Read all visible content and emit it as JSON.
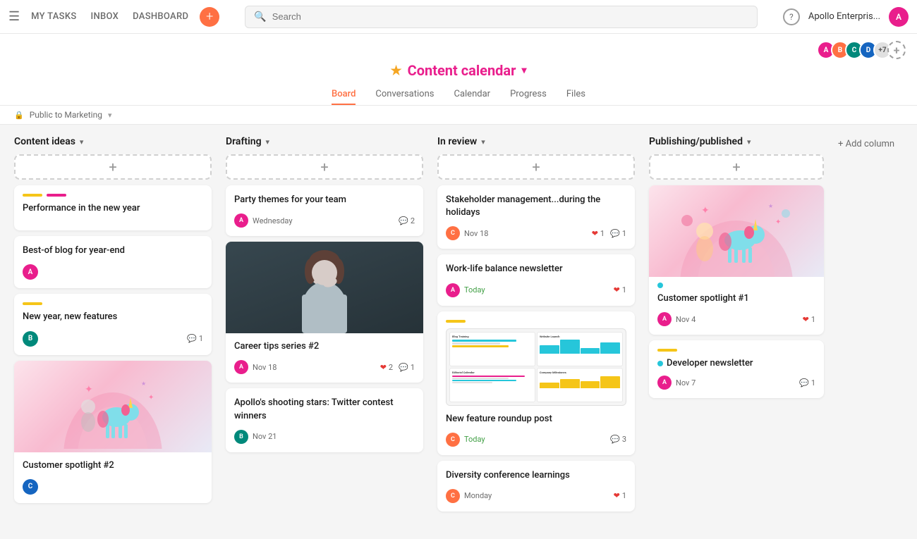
{
  "nav": {
    "menu_icon": "☰",
    "links": [
      "MY TASKS",
      "INBOX",
      "DASHBOARD"
    ],
    "add_icon": "+",
    "search_placeholder": "Search",
    "help_icon": "?",
    "company": "Apollo Enterpris...",
    "public_label": "Public to Marketing",
    "chevron": "▾"
  },
  "project": {
    "star": "★",
    "title": "Content calendar",
    "chevron": "▾",
    "tabs": [
      "Board",
      "Conversations",
      "Calendar",
      "Progress",
      "Files"
    ],
    "active_tab": 0
  },
  "columns": [
    {
      "id": "content-ideas",
      "title": "Content ideas",
      "cards": [
        {
          "tags": [
            "#f5c518",
            "#e91e8c"
          ],
          "title": "Performance in the new year",
          "hasImage": false,
          "hasTags": true
        },
        {
          "tags": [],
          "title": "Best-of blog for year-end",
          "avatar": "av-pink",
          "avatarInitial": "A",
          "hasTags": false
        },
        {
          "tags": [
            "#f5c518"
          ],
          "title": "New year, new features",
          "avatar": "av-teal",
          "avatarInitial": "B",
          "comments": 1,
          "hasTags": true
        },
        {
          "hasIllustration": "customer2",
          "title": "Customer spotlight #2",
          "avatar": "av-blue",
          "avatarInitial": "C",
          "hasTags": false
        }
      ]
    },
    {
      "id": "drafting",
      "title": "Drafting",
      "cards": [
        {
          "title": "Party themes for your team",
          "avatar": "av-pink",
          "avatarInitial": "A",
          "date": "Wednesday",
          "comments": 2,
          "hasTags": false
        },
        {
          "hasPersonPhoto": true,
          "title": "Career tips series #2",
          "avatar": "av-pink",
          "avatarInitial": "A",
          "date": "Nov 18",
          "hearts": 2,
          "comments": 1,
          "hasTags": false
        },
        {
          "title": "Apollo's shooting stars: Twitter contest winners",
          "avatar": "av-teal",
          "avatarInitial": "B",
          "date": "Nov 21",
          "hasTags": false
        }
      ]
    },
    {
      "id": "in-review",
      "title": "In review",
      "cards": [
        {
          "title": "Stakeholder management...during the holidays",
          "avatar": "av-orange",
          "avatarInitial": "C",
          "date": "Nov 18",
          "hearts": 1,
          "comments": 1,
          "hasTags": false
        },
        {
          "title": "Work-life balance newsletter",
          "avatar": "av-pink",
          "avatarInitial": "A",
          "date": "Today",
          "date_green": true,
          "hearts": 1,
          "hasTags": false
        },
        {
          "hasDashboard": true,
          "title": "New feature roundup post",
          "avatar": "av-orange",
          "avatarInitial": "C",
          "date": "Today",
          "date_green": true,
          "comments": 3,
          "hasTags": false,
          "tag_yellow": true
        },
        {
          "title": "Diversity conference learnings",
          "avatar": "av-orange",
          "avatarInitial": "C",
          "date": "Monday",
          "hearts": 1,
          "hasTags": false
        }
      ]
    },
    {
      "id": "publishing",
      "title": "Publishing/published",
      "cards": [
        {
          "hasUnicorn": true,
          "title": "Customer spotlight #1",
          "avatar": "av-pink",
          "avatarInitial": "A",
          "date": "Nov 4",
          "hearts": 1,
          "status_color": "#26c6da",
          "hasTags": false,
          "tag_teal": true
        },
        {
          "title": "Developer newsletter",
          "avatar": "av-pink",
          "avatarInitial": "A",
          "date": "Nov 7",
          "comments": 1,
          "status_color": "#f5c518",
          "hasTags": false,
          "tag_yellow": true
        }
      ]
    }
  ],
  "add_column": "+ Add column"
}
